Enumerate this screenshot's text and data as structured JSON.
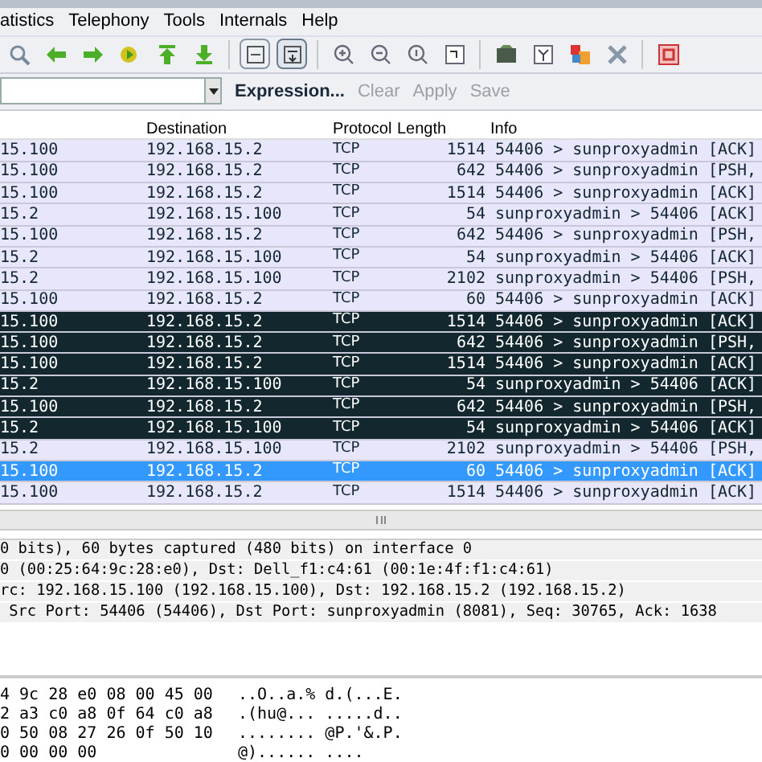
{
  "menu": [
    {
      "label": "atistics"
    },
    {
      "label": "Telephony"
    },
    {
      "label": "Tools"
    },
    {
      "label": "Internals"
    },
    {
      "label": "Help"
    }
  ],
  "toolbar": [
    {
      "kind": "find"
    },
    {
      "kind": "back"
    },
    {
      "kind": "forward"
    },
    {
      "kind": "goto"
    },
    {
      "kind": "first"
    },
    {
      "kind": "last"
    },
    {
      "kind": "sep"
    },
    {
      "kind": "colorize",
      "selected": false
    },
    {
      "kind": "autoscroll",
      "selected": true
    },
    {
      "kind": "sep"
    },
    {
      "kind": "zoomin"
    },
    {
      "kind": "zoomout"
    },
    {
      "kind": "zoomreset"
    },
    {
      "kind": "resize"
    },
    {
      "kind": "sep"
    },
    {
      "kind": "capfilter"
    },
    {
      "kind": "dispfilter"
    },
    {
      "kind": "coloring"
    },
    {
      "kind": "prefs"
    },
    {
      "kind": "sep"
    },
    {
      "kind": "help"
    }
  ],
  "filter": {
    "expression": "Expression...",
    "actions": [
      {
        "label": "Clear",
        "disabled": true
      },
      {
        "label": "Apply",
        "disabled": true
      },
      {
        "label": "Save",
        "disabled": true
      }
    ]
  },
  "packet_list": {
    "columns": [
      "",
      "Destination",
      "Protocol",
      "Length",
      "Info"
    ],
    "rows": [
      {
        "source": "15.100",
        "destination": "192.168.15.2",
        "protocol": "TCP",
        "length": "1514",
        "info": "54406 > sunproxyadmin [ACK]",
        "color": "#e7e6fb",
        "selected": false
      },
      {
        "source": "15.100",
        "destination": "192.168.15.2",
        "protocol": "TCP",
        "length": "642",
        "info": "54406 > sunproxyadmin [PSH,",
        "color": "#e7e6fb",
        "selected": false
      },
      {
        "source": "15.100",
        "destination": "192.168.15.2",
        "protocol": "TCP",
        "length": "1514",
        "info": "54406 > sunproxyadmin [ACK]",
        "color": "#e7e6fb",
        "selected": false
      },
      {
        "source": "15.2",
        "destination": "192.168.15.100",
        "protocol": "TCP",
        "length": "54",
        "info": "sunproxyadmin > 54406 [ACK]",
        "color": "#e7e6fb",
        "selected": false
      },
      {
        "source": "15.100",
        "destination": "192.168.15.2",
        "protocol": "TCP",
        "length": "642",
        "info": "54406 > sunproxyadmin [PSH,",
        "color": "#e7e6fb",
        "selected": false
      },
      {
        "source": "15.2",
        "destination": "192.168.15.100",
        "protocol": "TCP",
        "length": "54",
        "info": "sunproxyadmin > 54406 [ACK]",
        "color": "#e7e6fb",
        "selected": false
      },
      {
        "source": "15.2",
        "destination": "192.168.15.100",
        "protocol": "TCP",
        "length": "2102",
        "info": "sunproxyadmin > 54406 [PSH,",
        "color": "#e7e6fb",
        "selected": false
      },
      {
        "source": "15.100",
        "destination": "192.168.15.2",
        "protocol": "TCP",
        "length": "60",
        "info": "54406 > sunproxyadmin [ACK]",
        "color": "#e7e6fb",
        "selected": false
      },
      {
        "source": "15.100",
        "destination": "192.168.15.2",
        "protocol": "TCP",
        "length": "1514",
        "info": "54406 > sunproxyadmin [ACK]",
        "color": "#12272e",
        "selected": false
      },
      {
        "source": "15.100",
        "destination": "192.168.15.2",
        "protocol": "TCP",
        "length": "642",
        "info": "54406 > sunproxyadmin [PSH,",
        "color": "#12272e",
        "selected": false
      },
      {
        "source": "15.100",
        "destination": "192.168.15.2",
        "protocol": "TCP",
        "length": "1514",
        "info": "54406 > sunproxyadmin [ACK]",
        "color": "#12272e",
        "selected": false
      },
      {
        "source": "15.2",
        "destination": "192.168.15.100",
        "protocol": "TCP",
        "length": "54",
        "info": "sunproxyadmin > 54406 [ACK]",
        "color": "#12272e",
        "selected": false
      },
      {
        "source": "15.100",
        "destination": "192.168.15.2",
        "protocol": "TCP",
        "length": "642",
        "info": "54406 > sunproxyadmin [PSH,",
        "color": "#12272e",
        "selected": false
      },
      {
        "source": "15.2",
        "destination": "192.168.15.100",
        "protocol": "TCP",
        "length": "54",
        "info": "sunproxyadmin > 54406 [ACK]",
        "color": "#12272e",
        "selected": false
      },
      {
        "source": "15.2",
        "destination": "192.168.15.100",
        "protocol": "TCP",
        "length": "2102",
        "info": "sunproxyadmin > 54406 [PSH,",
        "color": "#e7e6fb",
        "selected": false
      },
      {
        "source": "15.100",
        "destination": "192.168.15.2",
        "protocol": "TCP",
        "length": "60",
        "info": "54406 > sunproxyadmin [ACK]",
        "selected": true
      },
      {
        "source": "15.100",
        "destination": "192.168.15.2",
        "protocol": "TCP",
        "length": "1514",
        "info": "54406 > sunproxyadmin [ACK]",
        "color": "#e7e6fb",
        "selected": false
      }
    ]
  },
  "details": [
    "0 bits), 60 bytes captured (480 bits) on interface 0",
    "0 (00:25:64:9c:28:e0), Dst: Dell_f1:c4:61 (00:1e:4f:f1:c4:61)",
    "rc: 192.168.15.100 (192.168.15.100), Dst: 192.168.15.2 (192.168.15.2)",
    " Src Port: 54406 (54406), Dst Port: sunproxyadmin (8081), Seq: 30765, Ack: 1638"
  ],
  "bytes": [
    {
      "hex": "4 9c 28 e0 08 00 45 00",
      "ascii": "..O..a.% d.(...E."
    },
    {
      "hex": "2 a3 c0 a8 0f 64 c0 a8",
      "ascii": ".(hu@... .....d.."
    },
    {
      "hex": "0 50 08 27 26 0f 50 10",
      "ascii": "........ @P.'&.P."
    },
    {
      "hex": "0 00 00 00",
      "ascii": "@)...... ...."
    }
  ]
}
